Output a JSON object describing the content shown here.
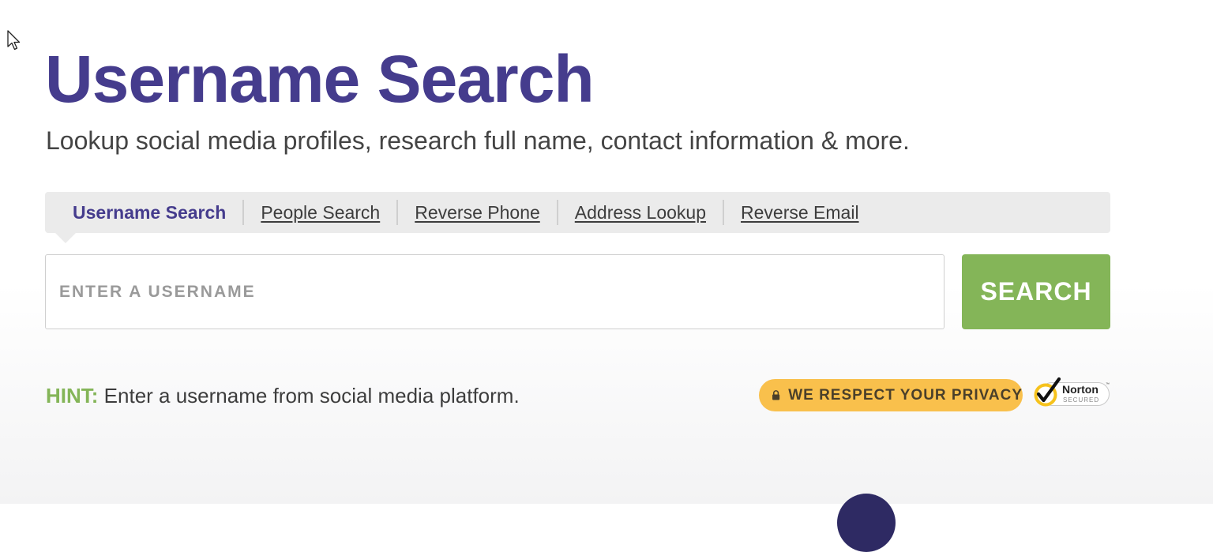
{
  "header": {
    "title": "Username Search",
    "subtitle": "Lookup social media profiles, research full name, contact information & more."
  },
  "tabs": [
    {
      "label": "Username Search",
      "active": true
    },
    {
      "label": "People Search",
      "active": false
    },
    {
      "label": "Reverse Phone",
      "active": false
    },
    {
      "label": "Address Lookup",
      "active": false
    },
    {
      "label": "Reverse Email",
      "active": false
    }
  ],
  "search": {
    "value": "",
    "placeholder": "ENTER A USERNAME",
    "button_label": "SEARCH"
  },
  "hint": {
    "label": "HINT:",
    "text": "Enter a username from social media platform."
  },
  "privacy": {
    "icon": "lock-icon",
    "text": "WE RESPECT YOUR PRIVACY"
  },
  "norton": {
    "icon": "checkmark-icon",
    "brand": "Norton",
    "trademark": "™",
    "subtext": "SECURED"
  },
  "colors": {
    "title_purple": "#453c8d",
    "search_green": "#84b558",
    "privacy_yellow": "#f9c04c",
    "norton_yellow": "#f6c21c",
    "tab_bar_gray": "#ebebeb"
  }
}
